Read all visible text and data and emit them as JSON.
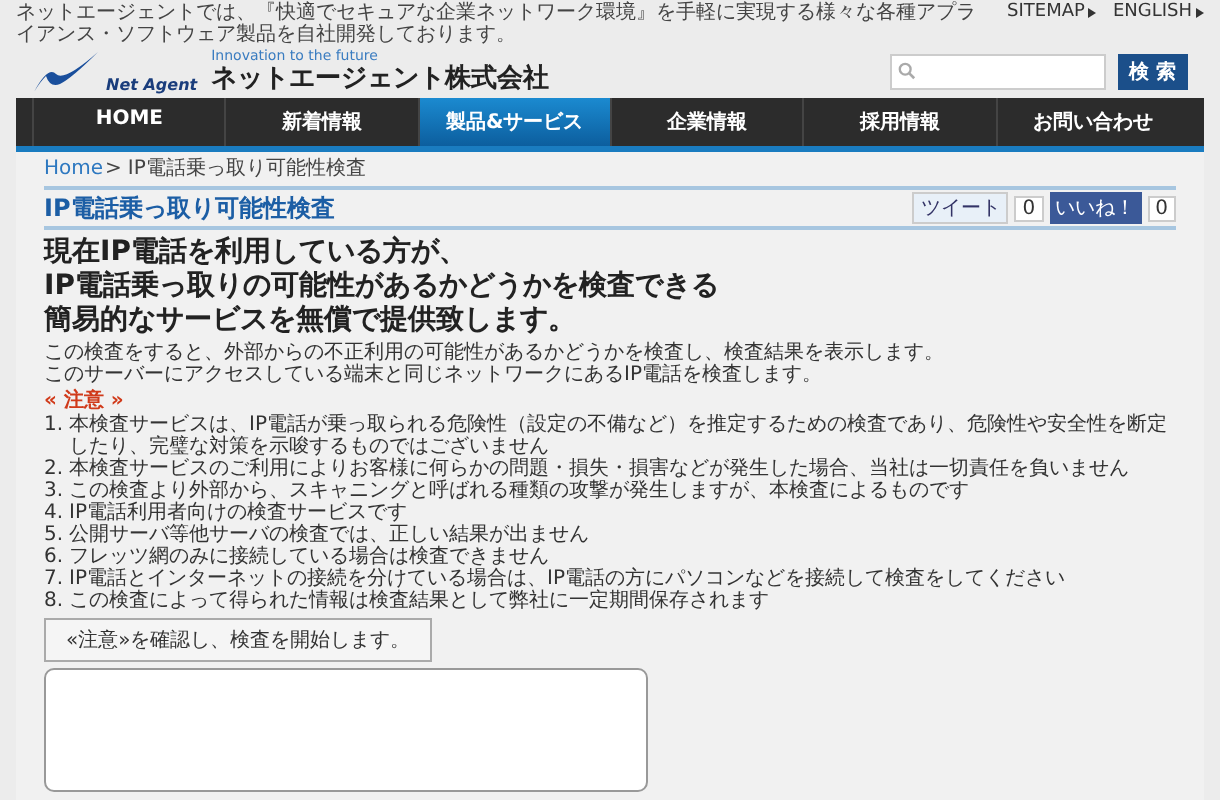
{
  "top_bar": {
    "tagline": "ネットエージェントでは、『快適でセキュアな企業ネットワーク環境』を手軽に実現する様々な各種アプライアンス・ソフトウェア製品を自社開発しております。",
    "links": [
      "SITEMAP",
      "ENGLISH"
    ]
  },
  "logo": {
    "mark_text": "Net Agent",
    "slogan": "Innovation to the future",
    "company": "ネットエージェント株式会社"
  },
  "search": {
    "button": "検 索"
  },
  "nav": [
    {
      "label": "HOME",
      "selected": false
    },
    {
      "label": "新着情報",
      "selected": false
    },
    {
      "label": "製品&サービス",
      "selected": true
    },
    {
      "label": "企業情報",
      "selected": false
    },
    {
      "label": "採用情報",
      "selected": false
    },
    {
      "label": "お問い合わせ",
      "selected": false
    }
  ],
  "breadcrumb": {
    "home": "Home",
    "separator": ">",
    "current": "IP電話乗っ取り可能性検査"
  },
  "title": "IP電話乗っ取り可能性検査",
  "social": {
    "tweet_label": "ツイート",
    "tweet_count": "0",
    "like_label": "いいね！",
    "like_count": "0"
  },
  "headline": [
    "現在IP電話を利用している方が、",
    "IP電話乗っ取りの可能性があるかどうかを検査できる",
    "簡易的なサービスを無償で提供致します。"
  ],
  "intro": [
    "この検査をすると、外部からの不正利用の可能性があるかどうかを検査し、検査結果を表示します。",
    "このサーバーにアクセスしている端末と同じネットワークにあるIP電話を検査します。"
  ],
  "notice": {
    "heading": "« 注意 »",
    "items": [
      {
        "number": "1.",
        "text": "本検査サービスは、IP電話が乗っ取られる危険性（設定の不備など）を推定するための検査であり、危険性や安全性を断定したり、完璧な対策を示唆するものではございません"
      },
      {
        "number": "2.",
        "text": "本検査サービスのご利用によりお客様に何らかの問題・損失・損害などが発生した場合、当社は一切責任を負いません"
      },
      {
        "number": "3.",
        "text": "この検査より外部から、スキャニングと呼ばれる種類の攻撃が発生しますが、本検査によるものです"
      },
      {
        "number": "4.",
        "text": "IP電話利用者向けの検査サービスです"
      },
      {
        "number": "5.",
        "text": "公開サーバ等他サーバの検査では、正しい結果が出ません"
      },
      {
        "number": "6.",
        "text": "フレッツ網のみに接続している場合は検査できません"
      },
      {
        "number": "7.",
        "text": "IP電話とインターネットの接続を分けている場合は、IP電話の方にパソコンなどを接続して検査をしてください"
      },
      {
        "number": "8.",
        "text": "この検査によって得られた情報は検査結果として弊社に一定期間保存されます"
      }
    ]
  },
  "start_button": "«注意»を確認し、検査を開始します。"
}
